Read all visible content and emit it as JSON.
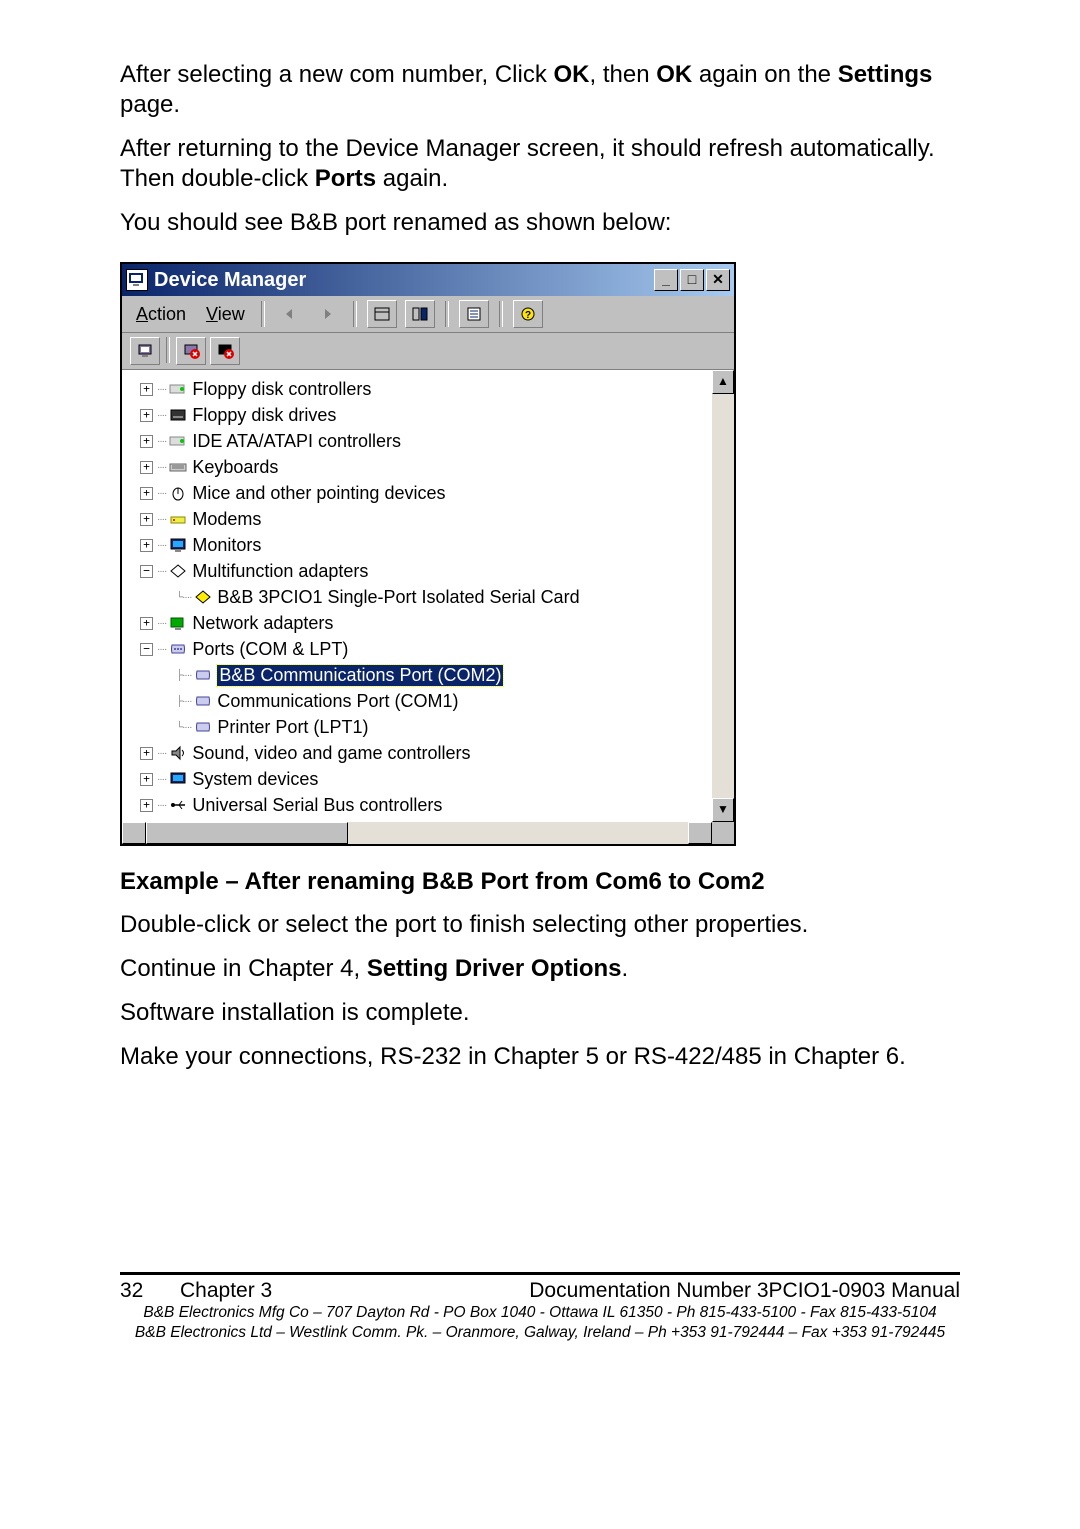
{
  "para1_a": "After selecting a new com number, Click ",
  "para1_b": "OK",
  "para1_c": ", then ",
  "para1_d": "OK",
  "para1_e": " again on the ",
  "para1_f": "Settings",
  "para1_g": " page.",
  "para2_a": "After returning to the Device Manager screen, it should refresh automatically. Then double-click ",
  "para2_b": "Ports",
  "para2_c": " again.",
  "para3": "You should see B&B port renamed as shown below:",
  "dm": {
    "title": "Device Manager",
    "menu_action_u": "A",
    "menu_action_rest": "ction",
    "menu_view_u": "V",
    "menu_view_rest": "iew",
    "tree": {
      "floppy_ctrl": "Floppy disk controllers",
      "floppy_drives": "Floppy disk drives",
      "ide": "IDE ATA/ATAPI controllers",
      "keyboards": "Keyboards",
      "mice": "Mice and other pointing devices",
      "modems": "Modems",
      "monitors": "Monitors",
      "multifunction": "Multifunction adapters",
      "bb_card": "B&B 3PCIO1 Single-Port Isolated Serial Card",
      "network": "Network adapters",
      "ports": "Ports (COM & LPT)",
      "bb_com2": "B&B Communications Port (COM2)",
      "com1": "Communications Port (COM1)",
      "lpt1": "Printer Port (LPT1)",
      "sound": "Sound, video and game controllers",
      "system": "System devices",
      "usb": "Universal Serial Bus controllers"
    }
  },
  "caption": "Example – After renaming B&B Port from Com6 to Com2",
  "para4": "Double-click or select the port to finish selecting other properties.",
  "para5_a": "Continue in Chapter 4, ",
  "para5_b": "Setting Driver Options",
  "para5_c": ".",
  "para6": "Software installation is complete.",
  "para7": "Make your connections, RS-232 in Chapter 5 or RS-422/485 in Chapter 6.",
  "footer": {
    "page_num": "32",
    "chapter": "Chapter 3",
    "doc": "Documentation Number 3PCIO1-0903 Manual",
    "addr1": "B&B Electronics Mfg Co – 707 Dayton Rd - PO Box 1040 - Ottawa IL 61350 - Ph 815-433-5100 - Fax 815-433-5104",
    "addr2": "B&B Electronics Ltd – Westlink Comm. Pk. – Oranmore, Galway, Ireland – Ph +353 91-792444 – Fax +353 91-792445"
  }
}
